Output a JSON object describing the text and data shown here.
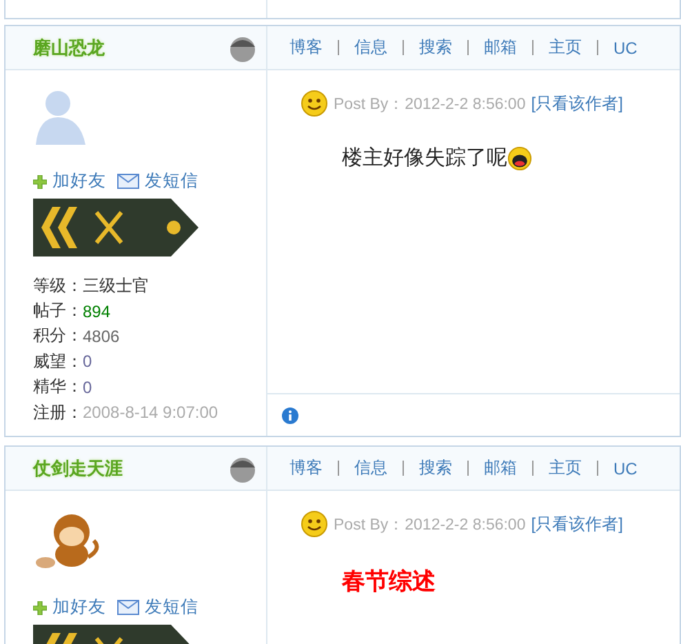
{
  "posts": [
    {
      "author": "磨山恐龙",
      "avatar": {
        "kind": "silhouette"
      },
      "links": [
        "加好友",
        "发短信"
      ],
      "stats": [
        {
          "label": "等级：",
          "value": "三级士官",
          "color": "#333333"
        },
        {
          "label": "帖子：",
          "value": "894",
          "color": "#008000"
        },
        {
          "label": "积分：",
          "value": "4806",
          "color": "#666666"
        },
        {
          "label": "威望：",
          "value": "0",
          "color": "#666699"
        },
        {
          "label": "精华：",
          "value": "0",
          "color": "#666699"
        },
        {
          "label": "注册：",
          "value": "2008-8-14 9:07:00",
          "color": "#aaaaaa"
        }
      ],
      "nav": [
        "博客",
        "信息",
        "搜索",
        "邮箱",
        "主页",
        "UC"
      ],
      "post_by": "Post By：2012-2-2 8:56:00",
      "author_only": "[只看该作者]",
      "body": {
        "kind": "text",
        "text": "楼主好像失踪了呢",
        "emoji": true
      },
      "footer": true
    },
    {
      "author": "仗剑走天涯",
      "avatar": {
        "kind": "monkey"
      },
      "links": [
        "加好友",
        "发短信"
      ],
      "nav": [
        "博客",
        "信息",
        "搜索",
        "邮箱",
        "主页",
        "UC"
      ],
      "post_by": "Post By：2012-2-2 8:56:00",
      "author_only": "[只看该作者]",
      "body": {
        "kind": "heading",
        "text": "春节综述",
        "emoji": false
      }
    }
  ]
}
